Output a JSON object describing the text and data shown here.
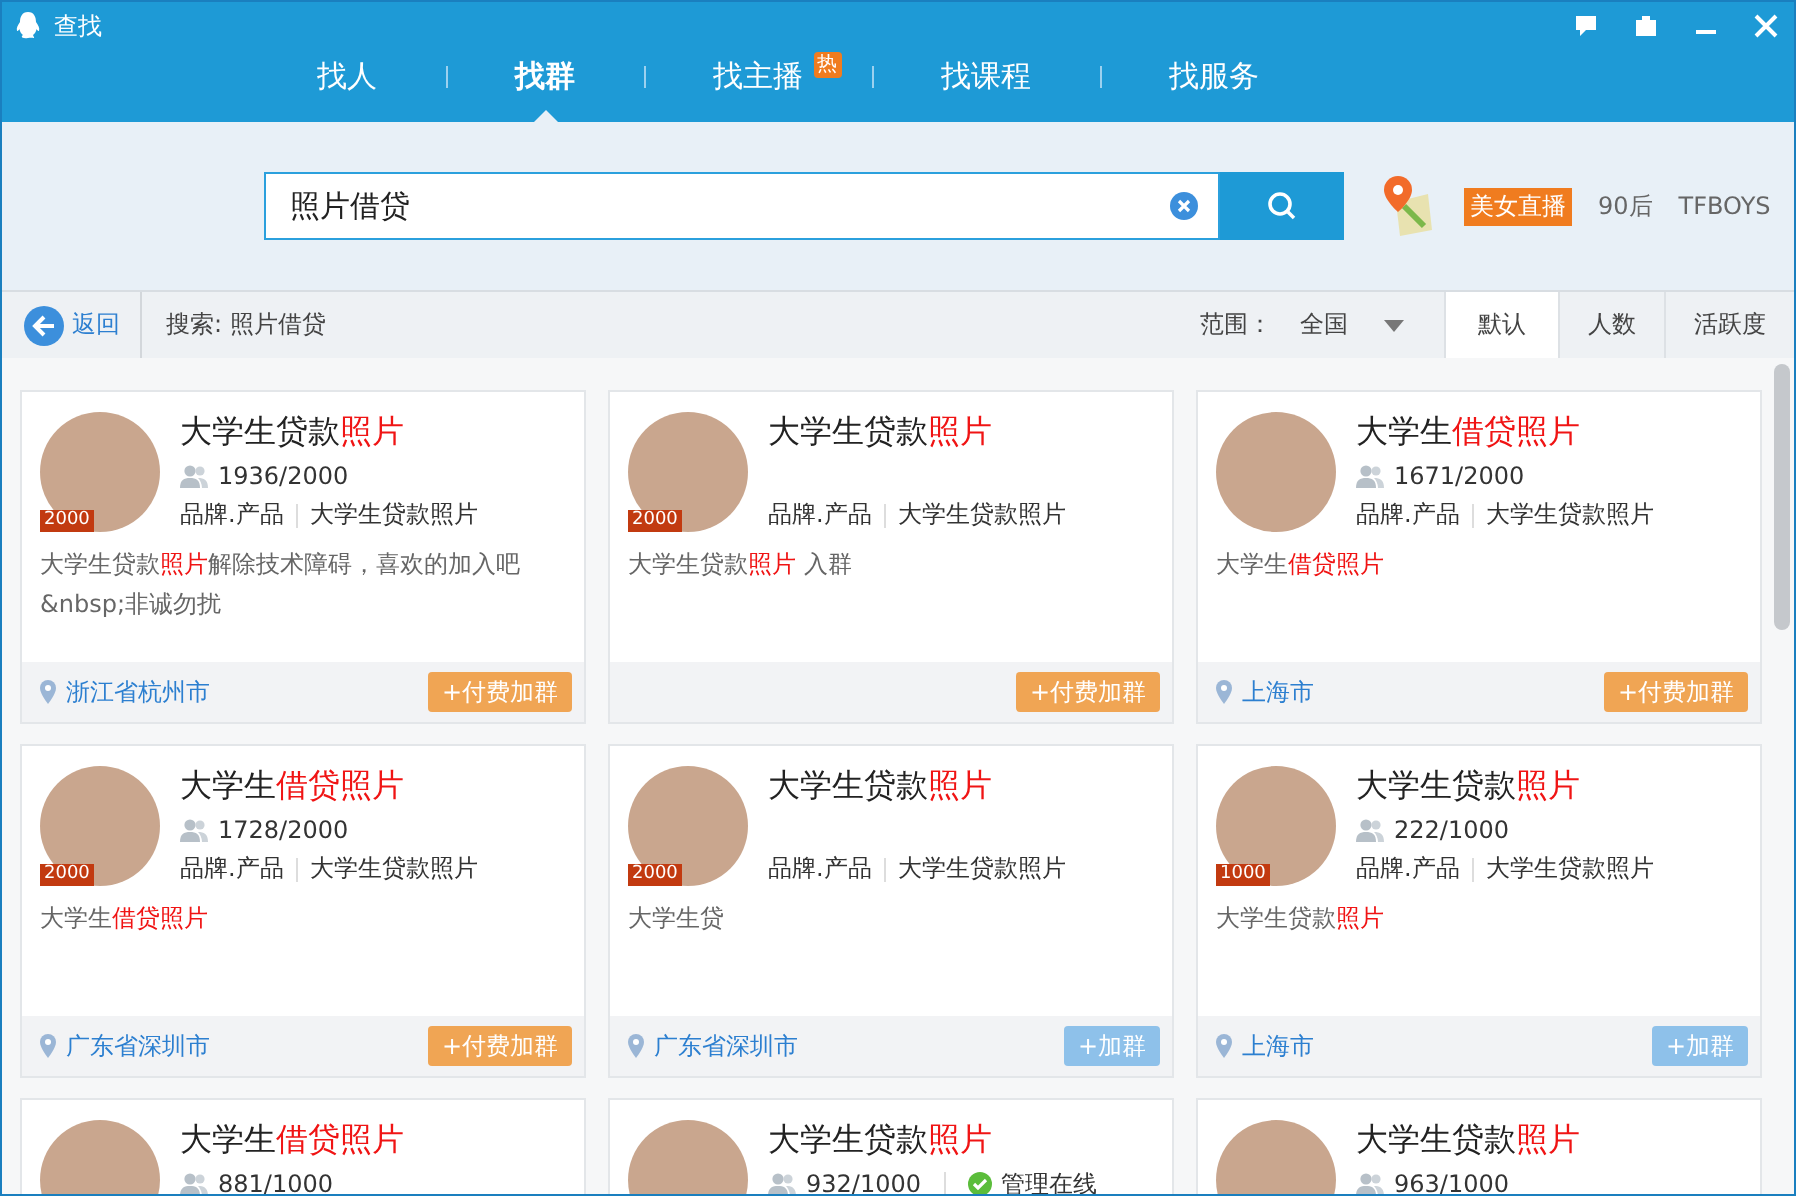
{
  "window": {
    "title": "查找"
  },
  "tabs": [
    {
      "label": "找人",
      "selected": false
    },
    {
      "label": "找群",
      "selected": true
    },
    {
      "label": "找主播",
      "selected": false,
      "hot_label": "热"
    },
    {
      "label": "找课程",
      "selected": false
    },
    {
      "label": "找服务",
      "selected": false
    }
  ],
  "search": {
    "value": "照片借贷"
  },
  "quick_links": [
    {
      "label": "美女直播",
      "kind": "tag"
    },
    {
      "label": "90后",
      "kind": "text"
    },
    {
      "label": "TFBOYS",
      "kind": "text"
    }
  ],
  "toolbar": {
    "back": "返回",
    "query": "搜索: 照片借贷",
    "range_label": "范围：",
    "range_value": "全国",
    "sorts": [
      {
        "label": "默认",
        "selected": true
      },
      {
        "label": "人数",
        "selected": false
      },
      {
        "label": "活跃度",
        "selected": false
      }
    ]
  },
  "cards": [
    {
      "badge": "2000",
      "title": [
        {
          "text": "大学生贷款",
          "highlight": false
        },
        {
          "text": "照片",
          "highlight": true
        }
      ],
      "members": "1936/2000",
      "tags": [
        "品牌.产品",
        "大学生贷款照片"
      ],
      "description": [
        {
          "text": "大学生贷款",
          "highlight": false
        },
        {
          "text": "照片",
          "highlight": true
        },
        {
          "text": "解除技术障碍，喜欢的加入吧&nbsp;非诚勿扰",
          "highlight": false
        }
      ],
      "location": "浙江省杭州市",
      "join": {
        "label": "+付费加群",
        "kind": "paid"
      }
    },
    {
      "badge": "2000",
      "title": [
        {
          "text": "大学生贷款",
          "highlight": false
        },
        {
          "text": "照片",
          "highlight": true
        }
      ],
      "tags": [
        "品牌.产品",
        "大学生贷款照片"
      ],
      "description": [
        {
          "text": "大学生贷款",
          "highlight": false
        },
        {
          "text": "照片",
          "highlight": true
        },
        {
          "text": " 入群",
          "highlight": false
        }
      ],
      "join": {
        "label": "+付费加群",
        "kind": "paid"
      }
    },
    {
      "title": [
        {
          "text": "大学生",
          "highlight": false
        },
        {
          "text": "借贷照片",
          "highlight": true
        }
      ],
      "members": "1671/2000",
      "tags": [
        "品牌.产品",
        "大学生贷款照片"
      ],
      "description": [
        {
          "text": "大学生",
          "highlight": false
        },
        {
          "text": "借贷照片",
          "highlight": true
        }
      ],
      "location": "上海市",
      "join": {
        "label": "+付费加群",
        "kind": "paid"
      }
    },
    {
      "badge": "2000",
      "title": [
        {
          "text": "大学生",
          "highlight": false
        },
        {
          "text": "借贷照片",
          "highlight": true
        }
      ],
      "members": "1728/2000",
      "tags": [
        "品牌.产品",
        "大学生贷款照片"
      ],
      "description": [
        {
          "text": "大学生",
          "highlight": false
        },
        {
          "text": "借贷照片",
          "highlight": true
        }
      ],
      "location": "广东省深圳市",
      "join": {
        "label": "+付费加群",
        "kind": "paid"
      }
    },
    {
      "badge": "2000",
      "title": [
        {
          "text": "大学生贷款",
          "highlight": false
        },
        {
          "text": "照片",
          "highlight": true
        }
      ],
      "tags": [
        "品牌.产品",
        "大学生贷款照片"
      ],
      "description": [
        {
          "text": "大学生贷",
          "highlight": false
        }
      ],
      "location": "广东省深圳市",
      "join": {
        "label": "+加群",
        "kind": "free"
      }
    },
    {
      "badge": "1000",
      "title": [
        {
          "text": "大学生贷款",
          "highlight": false
        },
        {
          "text": "照片",
          "highlight": true
        }
      ],
      "members": "222/1000",
      "tags": [
        "品牌.产品",
        "大学生贷款照片"
      ],
      "description": [
        {
          "text": "大学生贷款",
          "highlight": false
        },
        {
          "text": "照片",
          "highlight": true
        }
      ],
      "location": "上海市",
      "join": {
        "label": "+加群",
        "kind": "free"
      }
    },
    {
      "title": [
        {
          "text": "大学生",
          "highlight": false
        },
        {
          "text": "借贷照片",
          "highlight": true
        }
      ],
      "members": "881/1000"
    },
    {
      "title": [
        {
          "text": "大学生贷款",
          "highlight": false
        },
        {
          "text": "照片",
          "highlight": true
        }
      ],
      "members": "932/1000",
      "admin_online": "管理在线"
    },
    {
      "title": [
        {
          "text": "大学生贷款",
          "highlight": false
        },
        {
          "text": "照片",
          "highlight": true
        }
      ],
      "members": "963/1000"
    }
  ]
}
